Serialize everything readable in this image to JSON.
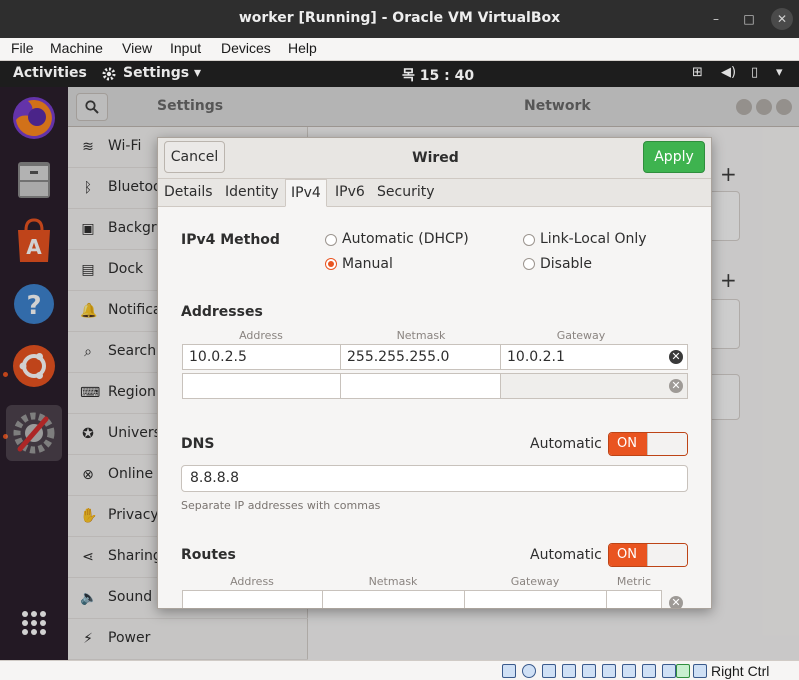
{
  "window": {
    "title": "worker [Running] - Oracle VM VirtualBox",
    "controls": [
      "–",
      "□",
      "✕"
    ]
  },
  "vb_menu": [
    "File",
    "Machine",
    "View",
    "Input",
    "Devices",
    "Help"
  ],
  "topbar": {
    "activities": "Activities",
    "app_menu": "Settings ▾",
    "clock": "목 15 : 40"
  },
  "settings": {
    "header_title": "Settings",
    "panel_title": "Network",
    "sidebar": [
      {
        "icon": "wifi-icon",
        "glyph": "≋",
        "label": "Wi-Fi"
      },
      {
        "icon": "bluetooth-icon",
        "glyph": "ᛒ",
        "label": "Bluetooth"
      },
      {
        "icon": "background-icon",
        "glyph": "▣",
        "label": "Background"
      },
      {
        "icon": "dock-icon",
        "glyph": "▤",
        "label": "Dock"
      },
      {
        "icon": "notifications-icon",
        "glyph": "🔔",
        "label": "Notifications"
      },
      {
        "icon": "search-icon",
        "glyph": "⌕",
        "label": "Search"
      },
      {
        "icon": "region-icon",
        "glyph": "⌨",
        "label": "Region & Language"
      },
      {
        "icon": "universal-access-icon",
        "glyph": "✪",
        "label": "Universal Access"
      },
      {
        "icon": "online-accounts-icon",
        "glyph": "⊗",
        "label": "Online Accounts"
      },
      {
        "icon": "privacy-icon",
        "glyph": "✋",
        "label": "Privacy"
      },
      {
        "icon": "sharing-icon",
        "glyph": "⋖",
        "label": "Sharing"
      },
      {
        "icon": "sound-icon",
        "glyph": "🔈",
        "label": "Sound"
      },
      {
        "icon": "power-icon",
        "glyph": "⚡",
        "label": "Power"
      }
    ]
  },
  "dialog": {
    "cancel": "Cancel",
    "title": "Wired",
    "apply": "Apply",
    "tabs": [
      "Details",
      "Identity",
      "IPv4",
      "IPv6",
      "Security"
    ],
    "active_tab": "IPv4",
    "ipv4_method_label": "IPv4 Method",
    "methods": {
      "automatic": "Automatic (DHCP)",
      "manual": "Manual",
      "link_local": "Link-Local Only",
      "disable": "Disable"
    },
    "selected_method": "Manual",
    "addresses_label": "Addresses",
    "address_cols": [
      "Address",
      "Netmask",
      "Gateway"
    ],
    "address_rows": [
      {
        "address": "10.0.2.5",
        "netmask": "255.255.255.0",
        "gateway": "10.0.2.1"
      },
      {
        "address": "",
        "netmask": "",
        "gateway": ""
      }
    ],
    "dns_label": "DNS",
    "dns_automatic_label": "Automatic",
    "dns_toggle": "ON",
    "dns_value": "8.8.8.8",
    "dns_hint": "Separate IP addresses with commas",
    "routes_label": "Routes",
    "routes_automatic_label": "Automatic",
    "routes_toggle": "ON",
    "route_cols": [
      "Address",
      "Netmask",
      "Gateway",
      "Metric"
    ]
  },
  "statusbar": {
    "host_key": "Right Ctrl"
  },
  "colors": {
    "accent": "#e95420",
    "apply_green": "#3eb34f"
  }
}
